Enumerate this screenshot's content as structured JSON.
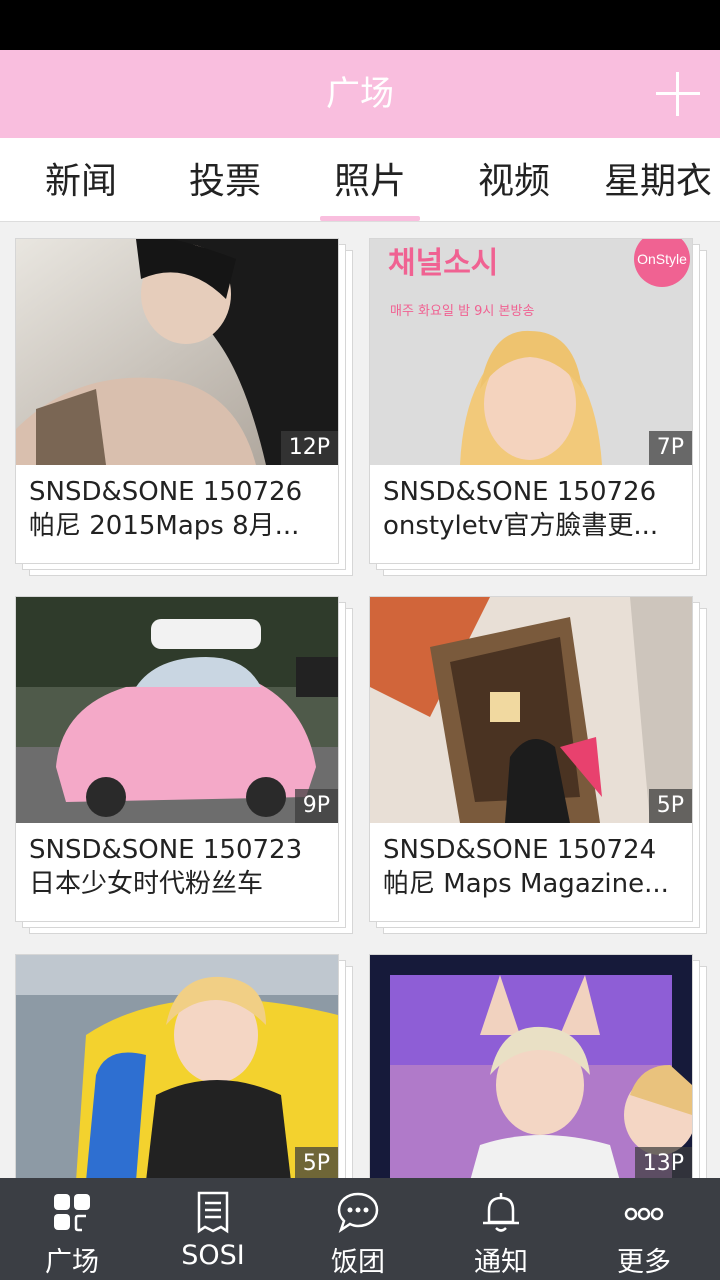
{
  "header": {
    "title": "广场"
  },
  "tabs": [
    {
      "label": "新闻",
      "selected": false
    },
    {
      "label": "投票",
      "selected": false
    },
    {
      "label": "照片",
      "selected": true
    },
    {
      "label": "视频",
      "selected": false
    },
    {
      "label": "星期衣",
      "selected": false
    }
  ],
  "accent_color": "#f9bede",
  "cards": [
    {
      "count": "12P",
      "line1": "SNSD&SONE 150726",
      "line2": "帕尼 2015Maps 8月..."
    },
    {
      "count": "7P",
      "line1": "SNSD&SONE 150726",
      "line2": "onstyletv官方臉書更...",
      "photo_text": "채널소시",
      "photo_subtext": "매주 화요일 밤 9시 본방송",
      "photo_logo": "OnStyle"
    },
    {
      "count": "9P",
      "line1": "SNSD&SONE 150723",
      "line2": "日本少女时代粉丝车"
    },
    {
      "count": "5P",
      "line1": "SNSD&SONE 150724",
      "line2": "帕尼 Maps Magazine..."
    },
    {
      "count": "5P",
      "line1": "",
      "line2": ""
    },
    {
      "count": "13P",
      "line1": "",
      "line2": ""
    }
  ],
  "bottom_nav": [
    {
      "label": "广场",
      "icon": "grid-icon"
    },
    {
      "label": "SOSI",
      "icon": "document-icon"
    },
    {
      "label": "饭团",
      "icon": "chat-bubble-icon"
    },
    {
      "label": "通知",
      "icon": "bell-icon"
    },
    {
      "label": "更多",
      "icon": "more-icon"
    }
  ]
}
